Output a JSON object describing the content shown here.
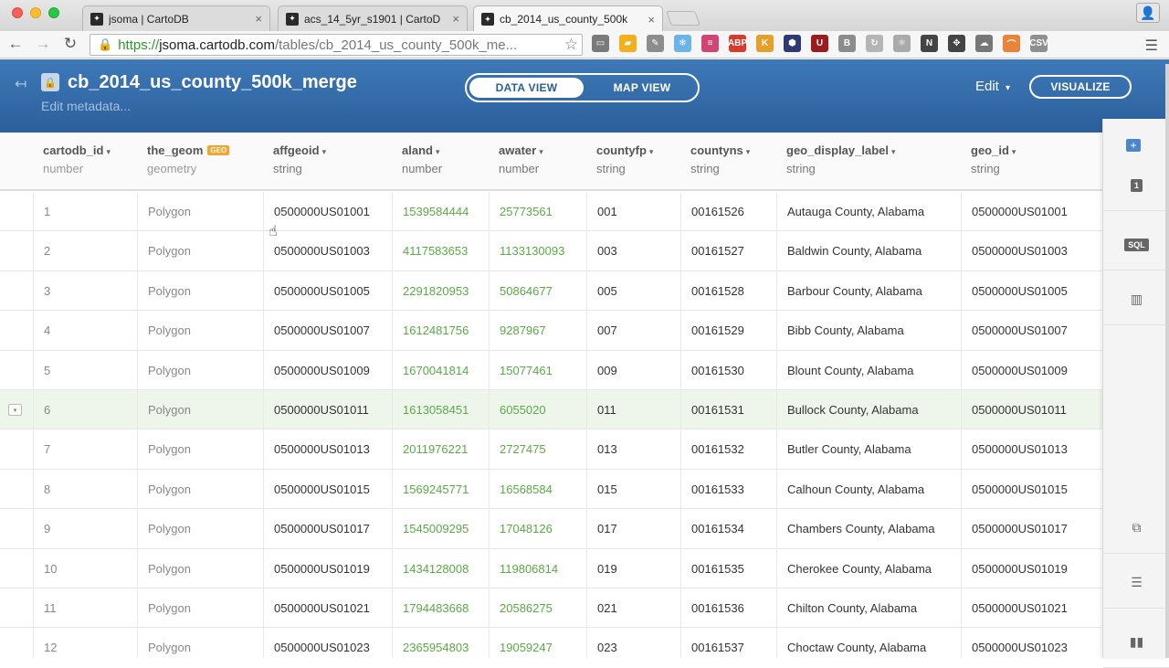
{
  "browser": {
    "tabs": [
      {
        "title": "jsoma | CartoDB",
        "active": false
      },
      {
        "title": "acs_14_5yr_s1901 | CartoD",
        "active": false
      },
      {
        "title": "cb_2014_us_county_500k",
        "active": true
      }
    ],
    "close_glyph": "×",
    "url": {
      "scheme": "https://",
      "host": "jsoma.cartodb.com",
      "path": "/tables/cb_2014_us_county_500k_me..."
    },
    "extensions": [
      {
        "name": "cast-icon",
        "color": "#7a7a7a",
        "label": "▭"
      },
      {
        "name": "folder-icon",
        "color": "#f2b01e",
        "label": "▰"
      },
      {
        "name": "pencil-icon",
        "color": "#8d8d8d",
        "label": "✎"
      },
      {
        "name": "snowflake-icon",
        "color": "#6bb3e8",
        "label": "❄"
      },
      {
        "name": "notes-icon",
        "color": "#d14474",
        "label": "≡"
      },
      {
        "name": "adblock-icon",
        "color": "#d83a2e",
        "label": "ABP"
      },
      {
        "name": "k-icon",
        "color": "#e5a02a",
        "label": "K"
      },
      {
        "name": "hexagon-icon",
        "color": "#2f3a73",
        "label": "⬢"
      },
      {
        "name": "ublock-icon",
        "color": "#9b1c1c",
        "label": "U"
      },
      {
        "name": "b-icon",
        "color": "#8c8c8c",
        "label": "B"
      },
      {
        "name": "refresh-icon",
        "color": "#b5b5b5",
        "label": "↻"
      },
      {
        "name": "atom-icon",
        "color": "#aaaaaa",
        "label": "⚛"
      },
      {
        "name": "n-icon",
        "color": "#444444",
        "label": "N"
      },
      {
        "name": "move-icon",
        "color": "#444444",
        "label": "✥"
      },
      {
        "name": "cloud-icon",
        "color": "#777777",
        "label": "☁"
      },
      {
        "name": "rainbow-icon",
        "color": "#e9833a",
        "label": "⌒"
      },
      {
        "name": "csv-icon",
        "color": "#8f8f8f",
        "label": "CSV"
      }
    ]
  },
  "header": {
    "title": "cb_2014_us_county_500k_merge",
    "edit_metadata": "Edit metadata...",
    "data_view": "DATA VIEW",
    "map_view": "MAP VIEW",
    "edit": "Edit",
    "visualize": "VISUALIZE",
    "accent": "#2b5f9b"
  },
  "table": {
    "columns": [
      {
        "name": "cartodb_id",
        "type": "number",
        "caret": "▾"
      },
      {
        "name": "the_geom",
        "type": "geometry",
        "badge": "GEO"
      },
      {
        "name": "affgeoid",
        "type": "string",
        "caret": "▾"
      },
      {
        "name": "aland",
        "type": "number",
        "caret": "▾"
      },
      {
        "name": "awater",
        "type": "number",
        "caret": "▾"
      },
      {
        "name": "countyfp",
        "type": "string",
        "caret": "▾"
      },
      {
        "name": "countyns",
        "type": "string",
        "caret": "▾"
      },
      {
        "name": "geo_display_label",
        "type": "string",
        "caret": "▾"
      },
      {
        "name": "geo_id",
        "type": "string",
        "caret": "▾"
      }
    ],
    "rows": [
      [
        "1",
        "Polygon",
        "0500000US01001",
        "1539584444",
        "25773561",
        "001",
        "00161526",
        "Autauga County, Alabama",
        "0500000US01001"
      ],
      [
        "2",
        "Polygon",
        "0500000US01003",
        "4117583653",
        "1133130093",
        "003",
        "00161527",
        "Baldwin County, Alabama",
        "0500000US01003"
      ],
      [
        "3",
        "Polygon",
        "0500000US01005",
        "2291820953",
        "50864677",
        "005",
        "00161528",
        "Barbour County, Alabama",
        "0500000US01005"
      ],
      [
        "4",
        "Polygon",
        "0500000US01007",
        "1612481756",
        "9287967",
        "007",
        "00161529",
        "Bibb County, Alabama",
        "0500000US01007"
      ],
      [
        "5",
        "Polygon",
        "0500000US01009",
        "1670041814",
        "15077461",
        "009",
        "00161530",
        "Blount County, Alabama",
        "0500000US01009"
      ],
      [
        "6",
        "Polygon",
        "0500000US01011",
        "1613058451",
        "6055020",
        "011",
        "00161531",
        "Bullock County, Alabama",
        "0500000US01011"
      ],
      [
        "7",
        "Polygon",
        "0500000US01013",
        "2011976221",
        "2727475",
        "013",
        "00161532",
        "Butler County, Alabama",
        "0500000US01013"
      ],
      [
        "8",
        "Polygon",
        "0500000US01015",
        "1569245771",
        "16568584",
        "015",
        "00161533",
        "Calhoun County, Alabama",
        "0500000US01015"
      ],
      [
        "9",
        "Polygon",
        "0500000US01017",
        "1545009295",
        "17048126",
        "017",
        "00161534",
        "Chambers County, Alabama",
        "0500000US01017"
      ],
      [
        "10",
        "Polygon",
        "0500000US01019",
        "1434128008",
        "119806814",
        "019",
        "00161535",
        "Cherokee County, Alabama",
        "0500000US01019"
      ],
      [
        "11",
        "Polygon",
        "0500000US01021",
        "1794483668",
        "20586275",
        "021",
        "00161536",
        "Chilton County, Alabama",
        "0500000US01021"
      ],
      [
        "12",
        "Polygon",
        "0500000US01023",
        "2365954803",
        "19059247",
        "023",
        "00161537",
        "Choctaw County, Alabama",
        "0500000US01023"
      ]
    ],
    "highlighted_row": 5,
    "number_color": "#5aaa45"
  },
  "right_panel": {
    "add_label": "+",
    "buttons": [
      {
        "name": "layer-1-icon",
        "label": "1"
      },
      {
        "name": "sql-icon",
        "label": "SQL"
      },
      {
        "name": "chart-icon",
        "label": "▥"
      },
      {
        "name": "merge-icon",
        "label": "⧉"
      },
      {
        "name": "add-row-icon",
        "label": "☰"
      },
      {
        "name": "add-column-icon",
        "label": "▮▮"
      }
    ]
  }
}
